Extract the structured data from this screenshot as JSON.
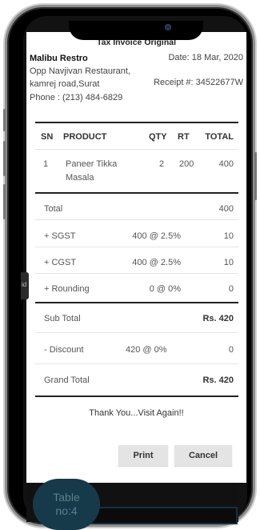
{
  "invoice": {
    "title": "Tax Invoice Original",
    "restaurant_name": "Malibu Restro",
    "date": "Date: 18 Mar, 2020",
    "address_line1": "Opp Navjivan Restaurant,",
    "address_line2": "kamrej road,Surat",
    "receipt_no": "Receipt #: 34522677W",
    "phone": "Phone : (213) 484-6829"
  },
  "table": {
    "headers": {
      "sn": "SN",
      "product": "PRODUCT",
      "qty": "QTY",
      "rt": "RT",
      "total": "TOTAL"
    },
    "items": [
      {
        "sn": "1",
        "product_line1": "Paneer Tikka",
        "product_line2": "Masala",
        "qty": "2",
        "rt": "200",
        "total": "400"
      }
    ]
  },
  "summary": {
    "total_label": "Total",
    "total_value": "400",
    "sgst_label": "+ SGST",
    "sgst_rate": "400 @ 2.5%",
    "sgst_value": "10",
    "cgst_label": "+ CGST",
    "cgst_rate": "400 @ 2.5%",
    "cgst_value": "10",
    "rounding_label": "+ Rounding",
    "rounding_rate": "0 @ 0%",
    "rounding_value": "0",
    "subtotal_label": "Sub Total",
    "subtotal_value": "Rs. 420",
    "discount_label": "- Discount",
    "discount_rate": "420 @ 0%",
    "discount_value": "0",
    "grand_total_label": "Grand Total",
    "grand_total_value": "Rs. 420"
  },
  "footer": {
    "thanks": "Thank You...Visit Again!!",
    "print_label": "Print",
    "cancel_label": "Cancel"
  },
  "app": {
    "table_badge_line1": "Table",
    "table_badge_line2": "no:4",
    "side_tab_label": "id"
  }
}
